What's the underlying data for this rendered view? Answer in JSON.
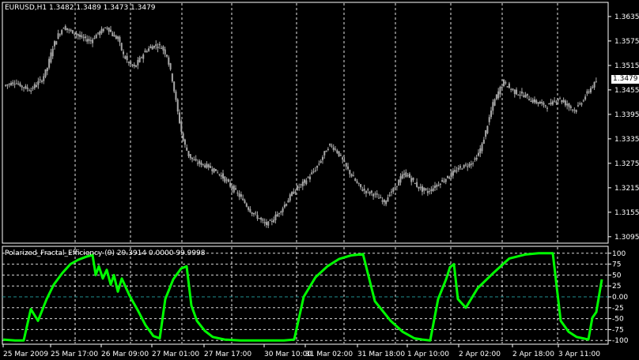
{
  "main_pane": {
    "title": "EURUSD,H1  1.3482 1.3489 1.3473 1.3479",
    "price_tag": "1.3479"
  },
  "indicator_pane": {
    "title": "Polarized_Fractal_Efficiency (9) 29.3914 0.0000 99.9998"
  },
  "chart_data": [
    {
      "type": "candlestick",
      "symbol": "EURUSD",
      "timeframe": "H1",
      "last_ohlc": {
        "open": 1.3482,
        "high": 1.3489,
        "low": 1.3473,
        "close": 1.3479
      },
      "y_ticks": [
        "1.3635",
        "1.3575",
        "1.3515",
        "1.3455",
        "1.3395",
        "1.3335",
        "1.3275",
        "1.3215",
        "1.3155",
        "1.3095"
      ],
      "ylim": [
        1.3085,
        1.366
      ],
      "x_ticks": [
        "25 Mar 2009",
        "25 Mar 17:00",
        "26 Mar 09:00",
        "27 Mar 01:00",
        "27 Mar 17:00",
        "30 Mar 10:00",
        "31 Mar 02:00",
        "31 Mar 18:00",
        "1 Apr 10:00",
        "2 Apr 02:00",
        "2 Apr 18:00",
        "3 Apr 11:00"
      ],
      "close_path": [
        1.3465,
        1.347,
        1.3475,
        1.3465,
        1.346,
        1.3455,
        1.347,
        1.348,
        1.351,
        1.356,
        1.359,
        1.361,
        1.36,
        1.3595,
        1.3585,
        1.358,
        1.3575,
        1.359,
        1.36,
        1.361,
        1.359,
        1.358,
        1.354,
        1.352,
        1.351,
        1.353,
        1.355,
        1.356,
        1.3565,
        1.356,
        1.354,
        1.348,
        1.34,
        1.333,
        1.3295,
        1.328,
        1.3275,
        1.327,
        1.3265,
        1.3255,
        1.3245,
        1.323,
        1.3215,
        1.32,
        1.3185,
        1.3165,
        1.315,
        1.314,
        1.3125,
        1.313,
        1.3145,
        1.316,
        1.318,
        1.32,
        1.3215,
        1.3225,
        1.324,
        1.3255,
        1.3275,
        1.33,
        1.332,
        1.331,
        1.329,
        1.3265,
        1.3245,
        1.3225,
        1.321,
        1.3205,
        1.32,
        1.319,
        1.318,
        1.32,
        1.3215,
        1.324,
        1.325,
        1.3235,
        1.322,
        1.321,
        1.3205,
        1.3215,
        1.3225,
        1.3235,
        1.3245,
        1.3255,
        1.3265,
        1.327,
        1.3275,
        1.329,
        1.332,
        1.337,
        1.342,
        1.345,
        1.3475,
        1.346,
        1.345,
        1.3445,
        1.344,
        1.343,
        1.3425,
        1.342,
        1.3415,
        1.3425,
        1.3435,
        1.3425,
        1.3415,
        1.3405,
        1.342,
        1.344,
        1.346,
        1.3475
      ]
    },
    {
      "type": "line",
      "series": [
        {
          "name": "Polarized_Fractal_Efficiency (9)",
          "color": "#00ff00"
        }
      ],
      "last_values": [
        29.3914,
        0.0,
        99.9998
      ],
      "y_ticks": [
        "100",
        "75",
        "50",
        "25",
        "0.00",
        "-25",
        "-50",
        "-75",
        "-100"
      ],
      "ylim": [
        -105,
        105
      ],
      "x": [
        0,
        15,
        26,
        35,
        44,
        55,
        64,
        75,
        85,
        95,
        105,
        113,
        117,
        121,
        126,
        131,
        136,
        140,
        145,
        150,
        160,
        170,
        180,
        190,
        198,
        205,
        215,
        225,
        232,
        238,
        245,
        255,
        265,
        280,
        300,
        320,
        340,
        355,
        368,
        380,
        395,
        410,
        425,
        440,
        455,
        470,
        490,
        505,
        520,
        530,
        540,
        550,
        560,
        565,
        570,
        575,
        585,
        600,
        620,
        640,
        660,
        677,
        684,
        695,
        705,
        715,
        725,
        733,
        740,
        745,
        750,
        757
      ],
      "values": [
        -98,
        -100,
        -100,
        -28,
        -55,
        -5,
        28,
        55,
        75,
        85,
        92,
        96,
        50,
        70,
        42,
        62,
        28,
        50,
        12,
        42,
        2,
        -30,
        -65,
        -90,
        -95,
        -5,
        40,
        65,
        70,
        -20,
        -55,
        -78,
        -92,
        -98,
        -100,
        -100,
        -100,
        -100,
        -98,
        0,
        45,
        70,
        87,
        95,
        98,
        -10,
        -55,
        -80,
        -95,
        -98,
        -100,
        -5,
        40,
        68,
        75,
        -5,
        -25,
        20,
        55,
        88,
        97,
        100,
        100,
        100,
        -55,
        -80,
        -92,
        -95,
        -98,
        -48,
        -35,
        40,
        25
      ]
    }
  ]
}
